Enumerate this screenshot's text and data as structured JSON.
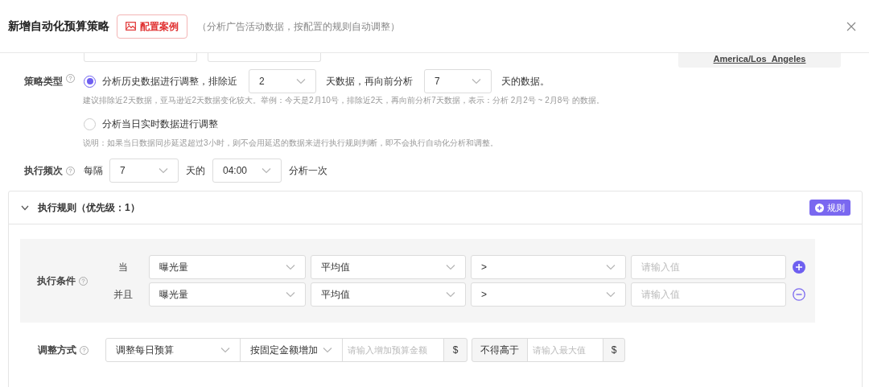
{
  "header": {
    "title": "新增自动化预算策略",
    "example_button": "配置案例",
    "subtitle": "（分析广告活动数据，按配置的规则自动调整）"
  },
  "partial_row": {
    "timezone": "America/Los_Angeles"
  },
  "strategy": {
    "label": "策略类型",
    "options": [
      {
        "selected": true,
        "parts": [
          "分析历史数据进行调整，排除近",
          "天数据，再向前分析",
          "天的数据。"
        ],
        "selects": [
          "2",
          "7"
        ],
        "hint": "建议排除近2天数据，亚马逊近2天数据变化较大。举例：今天是2月10号，排除近2天，再向前分析7天数据，表示：分析 2月2号 ~ 2月8号 的数据。"
      },
      {
        "selected": false,
        "parts": [
          "分析当日实时数据进行调整"
        ],
        "hint": "说明：如果当日数据同步延迟超过3小时，则不会用延迟的数据来进行执行规则判断，即不会执行自动化分析和调整。"
      }
    ]
  },
  "frequency": {
    "label": "执行频次",
    "prefix": "每隔",
    "days": "7",
    "middle": "天的",
    "time": "04:00",
    "suffix": "分析一次"
  },
  "rule": {
    "title": "执行规则（优先级：1）",
    "expanded": true,
    "add_button": "规则",
    "conditions_label": "执行条件",
    "conditions": [
      {
        "connector": "当",
        "metric": "曝光量",
        "aggregate": "平均值",
        "operator": ">",
        "placeholder": "请输入值",
        "kind": "add"
      },
      {
        "connector": "并且",
        "metric": "曝光量",
        "aggregate": "平均值",
        "operator": ">",
        "placeholder": "请输入值",
        "kind": "remove"
      }
    ],
    "adjust": {
      "label": "调整方式",
      "target": "调整每日预算",
      "method": "按固定金额增加",
      "amount_placeholder": "请输入增加预算金额",
      "currency": "$",
      "limit_label": "不得高于",
      "limit_placeholder": "请输入最大值",
      "limit_currency": "$"
    }
  }
}
